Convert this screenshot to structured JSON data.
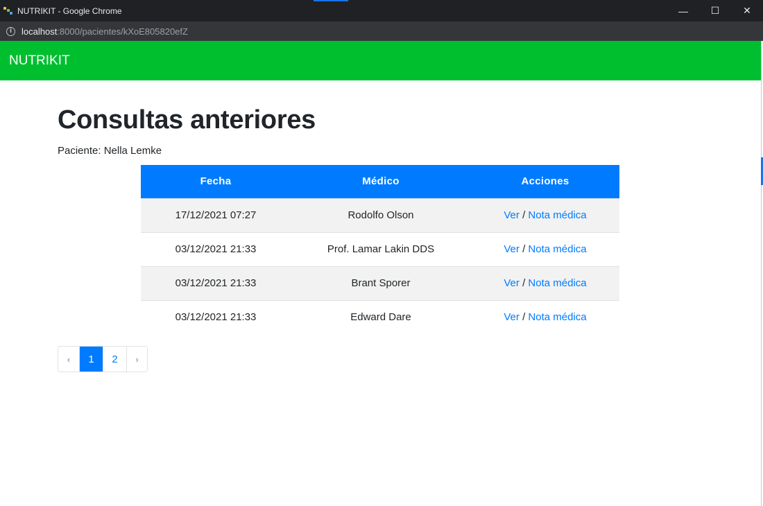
{
  "window": {
    "title": "NUTRIKIT - Google Chrome",
    "minimize_glyph": "—",
    "maximize_glyph": "☐",
    "close_glyph": "✕"
  },
  "address": {
    "host": "localhost",
    "path": ":8000/pacientes/kXoE805820efZ",
    "info_glyph": "i"
  },
  "navbar": {
    "brand": "NUTRIKIT"
  },
  "page": {
    "title": "Consultas anteriores",
    "patient_line": "Paciente: Nella Lemke"
  },
  "table": {
    "headers": [
      "Fecha",
      "Médico",
      "Acciones"
    ],
    "rows": [
      {
        "fecha": "17/12/2021 07:27",
        "medico": "Rodolfo Olson",
        "ver": "Ver",
        "sep": "/",
        "nota": "Nota médica"
      },
      {
        "fecha": "03/12/2021 21:33",
        "medico": "Prof. Lamar Lakin DDS",
        "ver": "Ver",
        "sep": "/",
        "nota": "Nota médica"
      },
      {
        "fecha": "03/12/2021 21:33",
        "medico": "Brant Sporer",
        "ver": "Ver",
        "sep": "/",
        "nota": "Nota médica"
      },
      {
        "fecha": "03/12/2021 21:33",
        "medico": "Edward Dare",
        "ver": "Ver",
        "sep": "/",
        "nota": "Nota médica"
      }
    ]
  },
  "pagination": {
    "prev": "‹",
    "pages": [
      "1",
      "2"
    ],
    "next": "›",
    "active_page": "1"
  },
  "colors": {
    "navbar": "#00bf2f",
    "table_header": "#007bff",
    "link": "#007bff"
  }
}
